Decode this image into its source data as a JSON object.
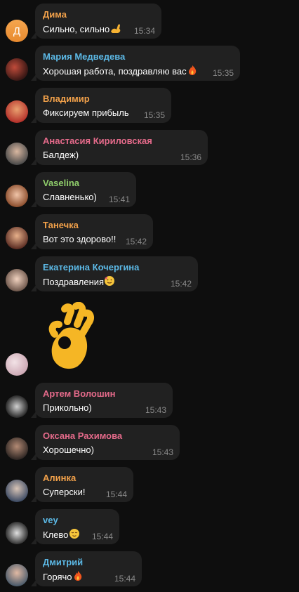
{
  "colors": {
    "background": "#0e0e0e",
    "bubble": "#212121",
    "orange_name": "#f2a14a",
    "blue_name": "#5cb9e6",
    "red_name": "#e46a8a",
    "green_name": "#8fcd6b",
    "time": "#8a8a8a"
  },
  "messages": [
    {
      "name": "Дима",
      "text": "Сильно, сильно",
      "emoji": "muscle-emoji",
      "time": "15:34",
      "name_color": "#f2a14a",
      "avatar_letter": "Д"
    },
    {
      "name": "Мария Медведева",
      "text": "Хорошая работа, поздравляю вас",
      "emoji": "fire-emoji",
      "time": "15:35",
      "name_color": "#5cb9e6"
    },
    {
      "name": "Владимир",
      "text": "Фиксируем прибыль",
      "time": "15:35",
      "name_color": "#f2a14a"
    },
    {
      "name": "Анастасия Кириловская",
      "text": "Балдеж)",
      "time": "15:36",
      "name_color": "#e46a8a"
    },
    {
      "name": "Vaselina",
      "text": "Славненько)",
      "time": "15:41",
      "name_color": "#8fcd6b"
    },
    {
      "name": "Танечка",
      "text": "Вот это здорово!!",
      "time": "15:42",
      "name_color": "#f2a14a"
    },
    {
      "name": "Екатерина Кочергина",
      "text": "Поздравления",
      "emoji": "party-face-emoji",
      "time": "15:42",
      "name_color": "#5cb9e6"
    },
    {
      "name": "Артем Волошин",
      "text": "Прикольно)",
      "time": "15:43",
      "name_color": "#e46a8a"
    },
    {
      "name": "Оксана Рахимова",
      "text": "Хорошечно)",
      "time": "15:43",
      "name_color": "#e46a8a"
    },
    {
      "name": "Алинка",
      "text": "Суперски!",
      "time": "15:44",
      "name_color": "#f2a14a"
    },
    {
      "name": "vey",
      "text": "Клево",
      "emoji": "relieved-face-emoji",
      "time": "15:44",
      "name_color": "#5cb9e6"
    },
    {
      "name": "Дмитрий",
      "text": "Горячо",
      "emoji": "fire-emoji",
      "time": "15:44",
      "name_color": "#5cb9e6"
    }
  ],
  "sticker": {
    "icon": "ok-hand-sticker"
  }
}
